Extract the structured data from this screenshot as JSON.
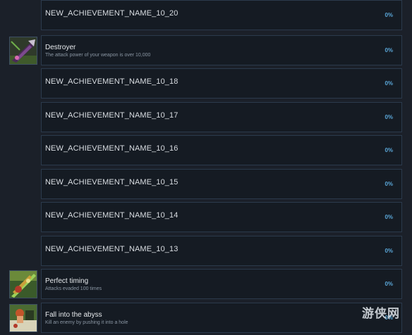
{
  "achievements": [
    {
      "title": "NEW_ACHIEVEMENT_NAME_10_20",
      "description": "",
      "percent": "0%",
      "icon": null
    },
    {
      "title": "Destroyer",
      "description": "The attack power of your weapon is over 10,000",
      "percent": "0%",
      "icon": "destroyer-icon"
    },
    {
      "title": "NEW_ACHIEVEMENT_NAME_10_18",
      "description": "",
      "percent": "0%",
      "icon": null
    },
    {
      "title": "NEW_ACHIEVEMENT_NAME_10_17",
      "description": "",
      "percent": "0%",
      "icon": null
    },
    {
      "title": "NEW_ACHIEVEMENT_NAME_10_16",
      "description": "",
      "percent": "0%",
      "icon": null
    },
    {
      "title": "NEW_ACHIEVEMENT_NAME_10_15",
      "description": "",
      "percent": "0%",
      "icon": null
    },
    {
      "title": "NEW_ACHIEVEMENT_NAME_10_14",
      "description": "",
      "percent": "0%",
      "icon": null
    },
    {
      "title": "NEW_ACHIEVEMENT_NAME_10_13",
      "description": "",
      "percent": "0%",
      "icon": null
    },
    {
      "title": "Perfect timing",
      "description": "Attacks evaded 100 times",
      "percent": "0%",
      "icon": "perfect-timing-icon"
    },
    {
      "title": "Fall into the abyss",
      "description": "Kill an enemy by pushing it into a hole",
      "percent": "0%",
      "icon": "fall-into-abyss-icon"
    }
  ],
  "watermark": {
    "text": "游侠网"
  },
  "colors": {
    "background": "#1b2029",
    "panel": "#151b23",
    "panel_border": "#2b3a4c",
    "percent": "#5aa7d8"
  }
}
